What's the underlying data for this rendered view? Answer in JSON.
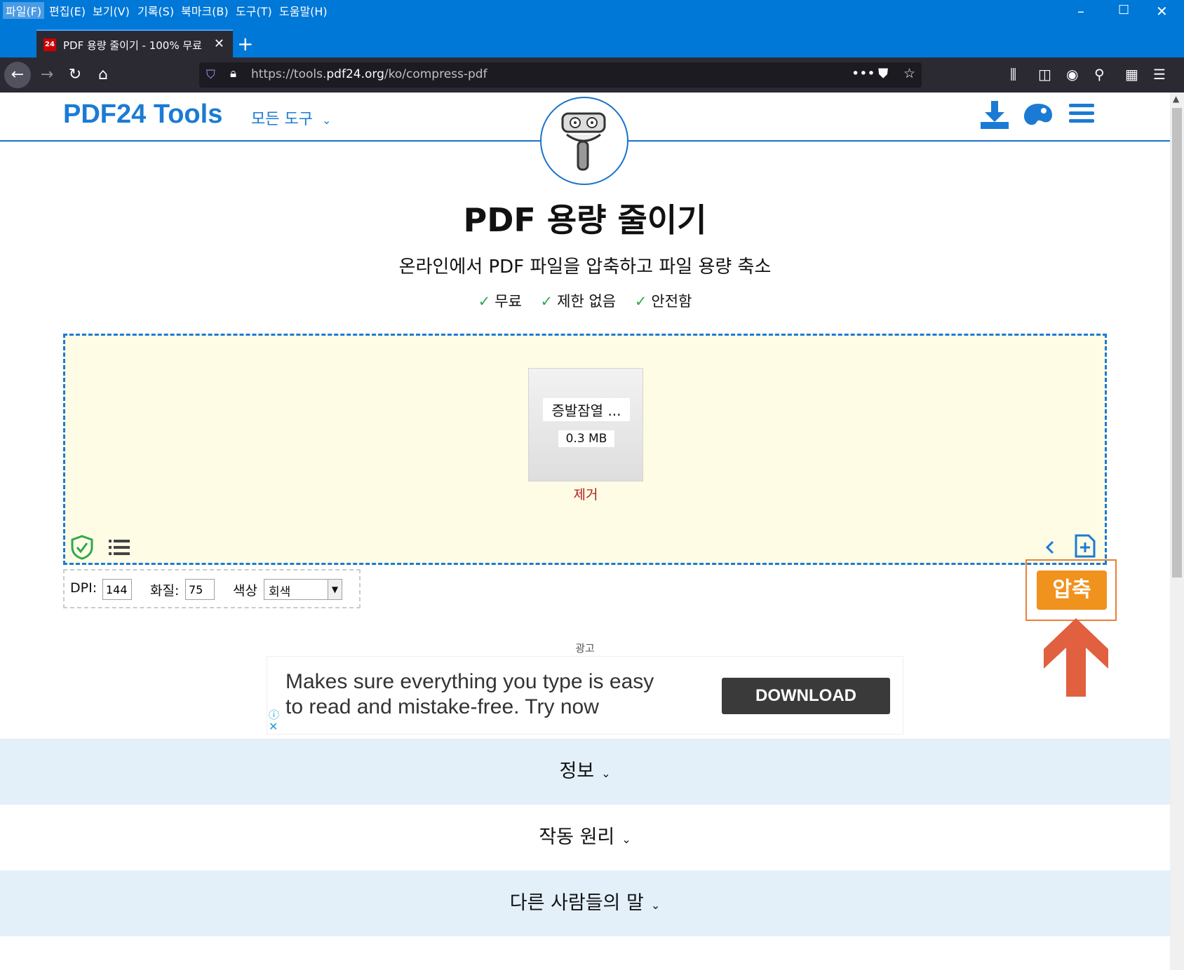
{
  "browser": {
    "menu": [
      "파일(F)",
      "편집(E)",
      "보기(V)",
      "기록(S)",
      "북마크(B)",
      "도구(T)",
      "도움말(H)"
    ],
    "tab_title": "PDF 용량 줄이기 - 100% 무료",
    "favicon_text": "24",
    "url_prefix": "https://tools.",
    "url_host": "pdf24.org",
    "url_path": "/ko/compress-pdf"
  },
  "header": {
    "logo": "PDF24 Tools",
    "all_tools": "모든 도구"
  },
  "main": {
    "title": "PDF 용량 줄이기",
    "subtitle": "온라인에서 PDF 파일을 압축하고 파일 용량 축소",
    "features": [
      "무료",
      "제한 없음",
      "안전함"
    ]
  },
  "file": {
    "name": "증발잠열 ...",
    "size": "0.3 MB",
    "remove_label": "제거"
  },
  "options": {
    "dpi_label": "DPI:",
    "dpi_value": "144",
    "quality_label": "화질:",
    "quality_value": "75",
    "color_label": "색상",
    "color_value": "회색"
  },
  "compress_label": "압축",
  "ad": {
    "label": "광고",
    "line1": "Makes sure everything you type is easy",
    "line2": "to read and mistake-free. Try now",
    "button": "DOWNLOAD"
  },
  "sections": [
    "정보",
    "작동 원리",
    "다른 사람들의 말"
  ],
  "colors": {
    "brand": "#1b7bd4",
    "accent": "#f0921e",
    "dropzone_bg": "#fffce5",
    "section_bg": "#e3f0fa"
  }
}
